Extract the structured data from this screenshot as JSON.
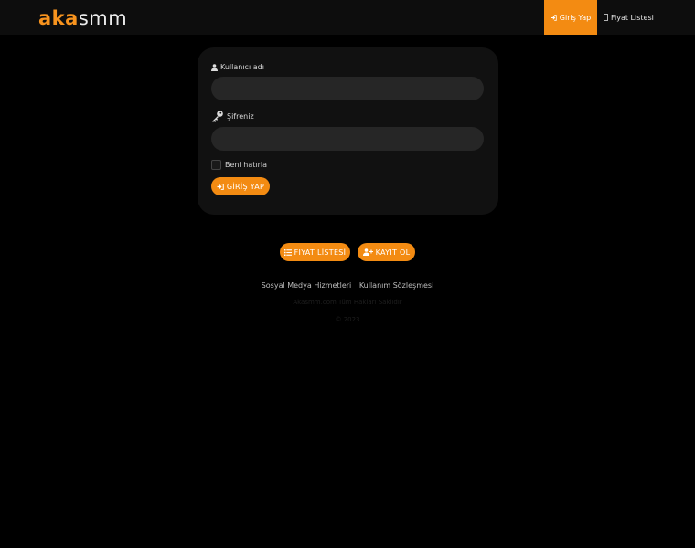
{
  "navbar": {
    "logo_part1": "aka",
    "logo_part2": "smm",
    "login_label": "Giriş Yap",
    "price_label": "Fiyat Listesi"
  },
  "login_form": {
    "username_label": "Kullanıcı adı",
    "password_label": "Şifreniz",
    "remember_label": "Beni hatırla",
    "submit_label": "GİRİŞ YAP"
  },
  "actions": {
    "price_list_label": "FIYAT LİSTESİ",
    "register_label": "KAYIT OL"
  },
  "footer": {
    "links": [
      "Sosyal Medya Hizmetleri",
      "Kullanım Sözleşmesi"
    ],
    "line1": "Akasmm.com Tüm Hakları Saklıdır",
    "line2": "© 2023"
  },
  "colors": {
    "accent": "#f38b12",
    "background": "#000000",
    "card": "#111111",
    "input": "#262626"
  }
}
